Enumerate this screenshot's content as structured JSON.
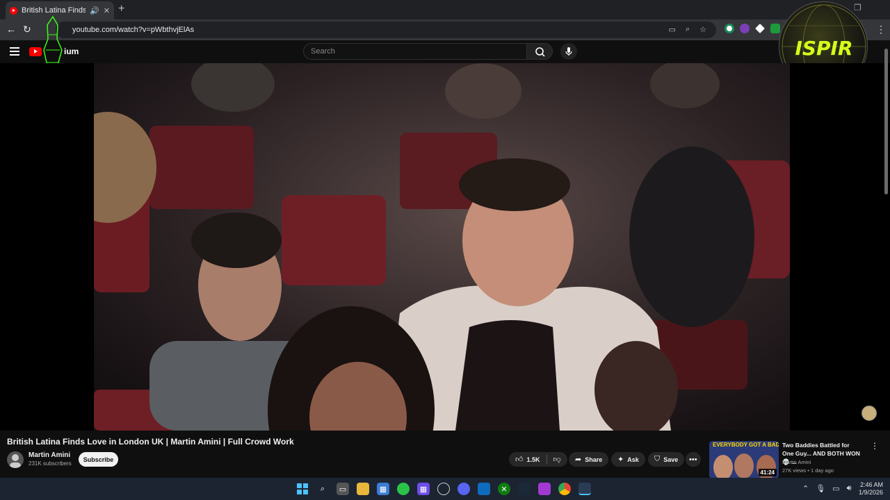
{
  "browser": {
    "tab_title": "British Latina Finds Love in",
    "tab_speaker_icon": "speaker-icon",
    "url": "youtube.com/watch?v=pWbthvjElAs"
  },
  "youtube": {
    "logo_text": "ium",
    "search_placeholder": "Search"
  },
  "video": {
    "title": "British Latina Finds Love in London UK | Martin Amini | Full Crowd Work",
    "channel": "Martin Amini",
    "subscribers": "231K subscribers",
    "subscribe_label": "Subscribe",
    "likes": "1.5K",
    "share_label": "Share",
    "ask_label": "Ask",
    "save_label": "Save"
  },
  "recommended": {
    "thumb_text": "EVERYBODY GOT A BADDIE",
    "duration": "41:24",
    "title": "Two Baddies Battled for One Guy... AND BOTH WON 💀 ...",
    "channel": "Martin Amini",
    "meta": "27K views • 1 day ago"
  },
  "overlays": {
    "top_right_logo_text": "ISPIR"
  },
  "system": {
    "time": "2:46 AM",
    "date": "1/9/2026"
  },
  "colors": {
    "youtube_red": "#ff0000",
    "background": "#0f0f0f",
    "taskbar": "#1c2432"
  }
}
